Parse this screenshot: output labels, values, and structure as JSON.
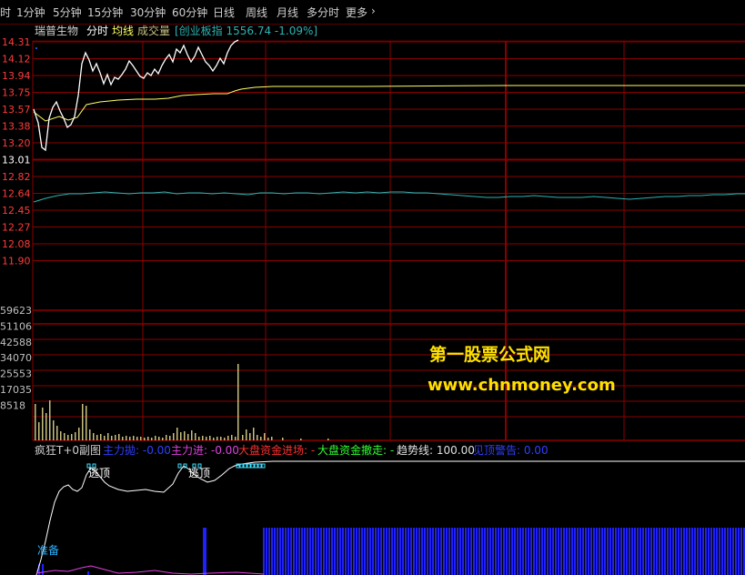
{
  "tabs": [
    "时",
    "1分钟",
    "5分钟",
    "15分钟",
    "30分钟",
    "60分钟",
    "日线",
    "周线",
    "月线",
    "多分时",
    "更多"
  ],
  "more_icon": "chevron-right-icon",
  "header": {
    "stock_name": "瑞普生物",
    "mode": "分时",
    "avg_line": "均线",
    "volume": "成交量",
    "index_info": "[创业板指 1556.74 -1.09%]"
  },
  "price_axis": [
    "14.31",
    "14.12",
    "13.94",
    "13.75",
    "13.57",
    "13.38",
    "13.20",
    "13.01",
    "12.82",
    "12.64",
    "12.45",
    "12.27",
    "12.08",
    "11.90"
  ],
  "volume_axis": [
    "59623",
    "51106",
    "42588",
    "34070",
    "25553",
    "17035",
    "8518"
  ],
  "indicator": {
    "name": "疯狂T+0副图",
    "items": [
      {
        "label": "主力拋: -0.00",
        "color": "#2f3fff"
      },
      {
        "label": "主力进: -0.00",
        "color": "#e040e0"
      },
      {
        "label": "大盘资金进场: -",
        "color": "#ff3030"
      },
      {
        "label": "大盘资金撤走: -",
        "color": "#30ff30"
      },
      {
        "label": "趋势线: 100.00",
        "color": "#e0e0e0"
      },
      {
        "label": "见顶警告: 0.00",
        "color": "#2f3fff"
      }
    ],
    "signal_top": "逃顶",
    "signal_ready": "准备"
  },
  "watermark": {
    "name": "第一股票公式网",
    "url": "www.chnmoney.com"
  },
  "colors": {
    "grid": "#8a0000",
    "axis_red": "#ff3b3b",
    "axis_gray": "#c0c0c0",
    "price_line": "#ffffff",
    "avg_line": "#ffff66",
    "index_line": "#2bb3b3",
    "volume_bar": "#c8c080",
    "blue_bar": "#2020ff",
    "watermark": "#ffe000"
  }
}
